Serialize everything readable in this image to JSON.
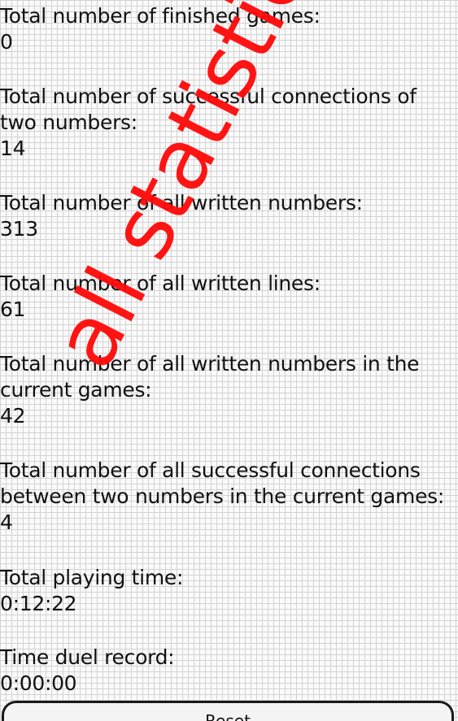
{
  "statistics": [
    {
      "label": "Total number of finished games:",
      "value": "0"
    },
    {
      "label": "Total number of successful connections of two numbers:",
      "value": "14"
    },
    {
      "label": "Total number of all written numbers:",
      "value": "313"
    },
    {
      "label": "Total number of all written lines:",
      "value": "61"
    },
    {
      "label": "Total number of all written numbers in the current games:",
      "value": "42"
    },
    {
      "label": "Total number of all successful connections between two numbers in the current games:",
      "value": "4"
    },
    {
      "label": "Total playing time:",
      "value": "0:12:22"
    },
    {
      "label": "Time duel record:",
      "value": "0:00:00"
    }
  ],
  "watermark": "all statistics",
  "reset_button": {
    "label": "Reset"
  },
  "colors": {
    "watermark": "#ff0a0a",
    "grid": "#d2d2d2",
    "background": "#fafafa"
  }
}
